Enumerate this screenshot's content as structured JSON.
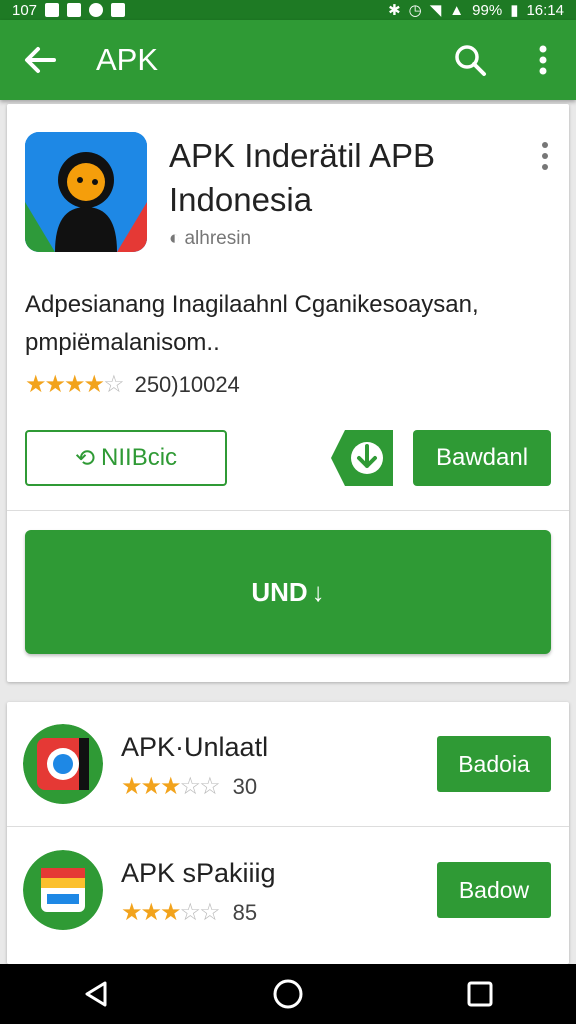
{
  "status_bar": {
    "left_text": "107",
    "battery": "99%",
    "time": "16:14"
  },
  "appbar": {
    "title": "APK"
  },
  "app": {
    "title": "APK Inderätil APB Indonesia",
    "developer": "alhresin",
    "description": "Adpesianang Inagilaahnl Cganikesoaysan, pmpiëmalanisom..",
    "rating_stars": 3.5,
    "rating_count": "250)10024",
    "secondary_button": "NIIBcic",
    "primary_button": "Bawdanl",
    "big_button": "UND"
  },
  "related": [
    {
      "title": "APK·Unlaatl",
      "rating_stars": 3.5,
      "count": "30",
      "button": "Badoia"
    },
    {
      "title": "APK sPakiiig",
      "rating_stars": 3.5,
      "count": "85",
      "button": "Badow"
    }
  ],
  "colors": {
    "accent": "#2f9a35",
    "status_bar": "#1e7a24",
    "star": "#f2a31c"
  }
}
